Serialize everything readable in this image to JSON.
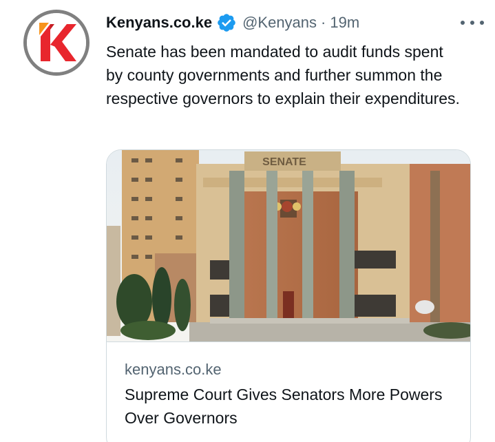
{
  "tweet": {
    "author_name": "Kenyans.co.ke",
    "handle": "@Kenyans",
    "separator": "·",
    "time": "19m",
    "text": "Senate has been mandated to audit funds spent by county governments and further summon the respective governors to explain their expenditures."
  },
  "card": {
    "image_sign_text": "SENATE",
    "domain": "kenyans.co.ke",
    "title": "Supreme Court Gives Senators More Powers Over Governors"
  },
  "icons": {
    "avatar": "kenyans-logo-icon",
    "verified": "verified-badge-icon",
    "more": "more-options-icon"
  },
  "colors": {
    "text": "#0f1419",
    "secondary": "#536471",
    "verified": "#1d9bf0",
    "logo_red": "#e8262d",
    "logo_orange": "#f7941d",
    "border": "#cfd9de"
  }
}
